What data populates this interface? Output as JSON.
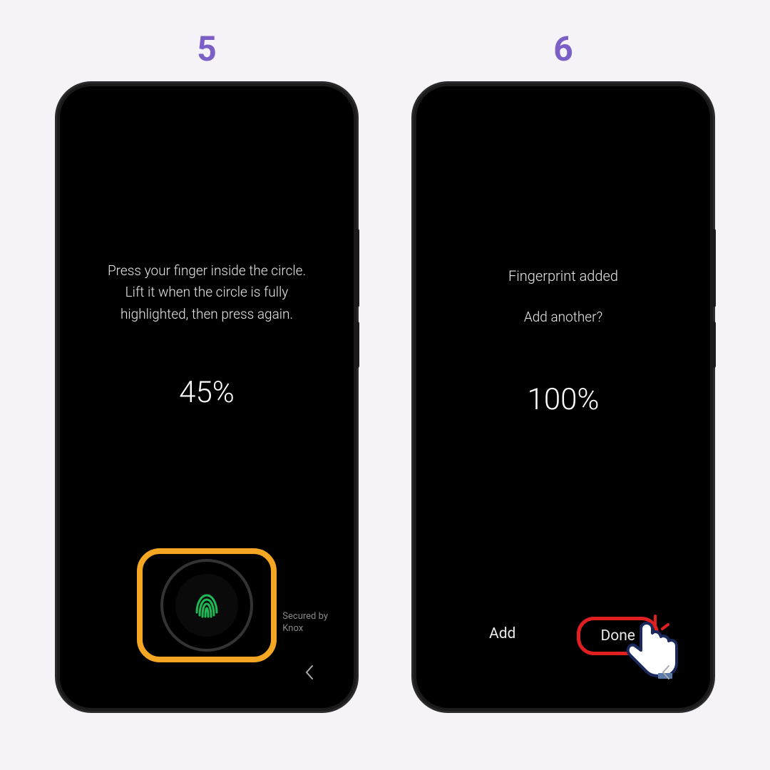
{
  "steps": [
    {
      "number": "5",
      "instruction": "Press your finger inside the circle. Lift it when the circle is fully highlighted, then press again.",
      "percent": "45%",
      "secured_line1": "Secured by",
      "secured_line2": "Knox"
    },
    {
      "number": "6",
      "title": "Fingerprint added",
      "subtitle": "Add another?",
      "percent": "100%",
      "add_label": "Add",
      "done_label": "Done"
    }
  ],
  "colors": {
    "accent": "#7b5fc7",
    "highlight_orange": "#f5a623",
    "highlight_red": "#e02020",
    "fingerprint_green": "#1db954"
  }
}
